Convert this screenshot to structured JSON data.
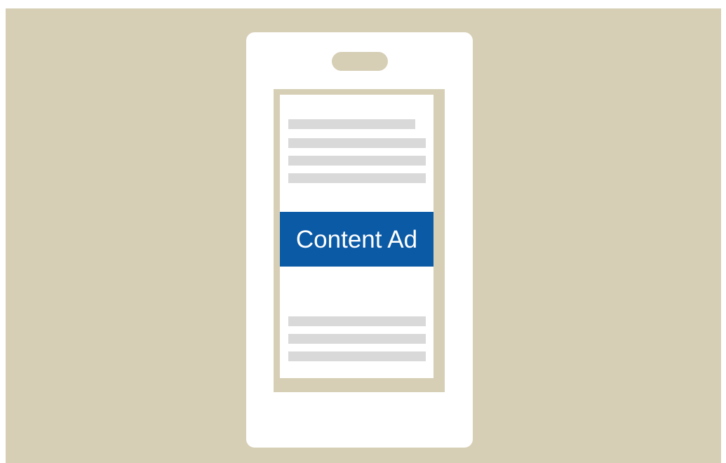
{
  "colors": {
    "backdrop": "#d6cfb6",
    "phone_body": "#ffffff",
    "screen_frame": "#d6cfb6",
    "placeholder_line": "#d9d9d9",
    "ad_background": "#0b5aa6",
    "ad_text": "#ffffff"
  },
  "ad": {
    "label": "Content Ad"
  }
}
